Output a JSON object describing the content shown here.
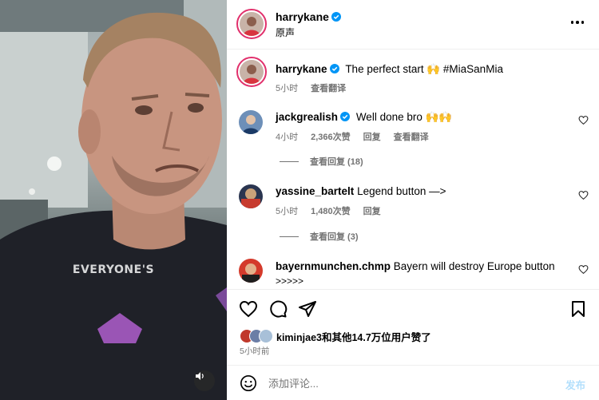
{
  "video": {
    "caption": "EVERYONE'S",
    "mute_icon": "speaker-icon"
  },
  "header": {
    "username": "harrykane",
    "subtitle": "原声",
    "more_icon": "more-horizontal-icon"
  },
  "caption_comment": {
    "username": "harrykane",
    "text": "The perfect start 🙌 #MiaSanMia",
    "time": "5小时",
    "translate": "查看翻译"
  },
  "comments": [
    {
      "username": "jackgrealish",
      "verified": true,
      "text": "Well done bro 🙌🙌",
      "time": "4小时",
      "likes": "2,366次赞",
      "reply": "回复",
      "translate": "查看翻译",
      "view_replies": "查看回复 (18)"
    },
    {
      "username": "yassine_bartelt",
      "verified": false,
      "text": "Legend button —>",
      "time": "5小时",
      "likes": "1,480次赞",
      "reply": "回复",
      "view_replies": "查看回复 (3)"
    },
    {
      "username": "bayernmunchen.chmp",
      "verified": false,
      "text": "Bayern will destroy Europe button",
      "text_cont": ">>>>>"
    }
  ],
  "actions": {
    "like_icon": "heart-icon",
    "comment_icon": "comment-icon",
    "share_icon": "send-icon",
    "save_icon": "bookmark-icon"
  },
  "likes_line": "kiminjae3和其他14.7万位用户赞了",
  "timestamp": "5小时前",
  "composer": {
    "placeholder": "添加评论...",
    "post_label": "发布",
    "emoji_icon": "emoji-icon"
  },
  "colors": {
    "verified_blue": "#0095f6",
    "story_ring": "#e1306c",
    "muted_text": "#737373",
    "post_disabled": "#b2dffc"
  }
}
